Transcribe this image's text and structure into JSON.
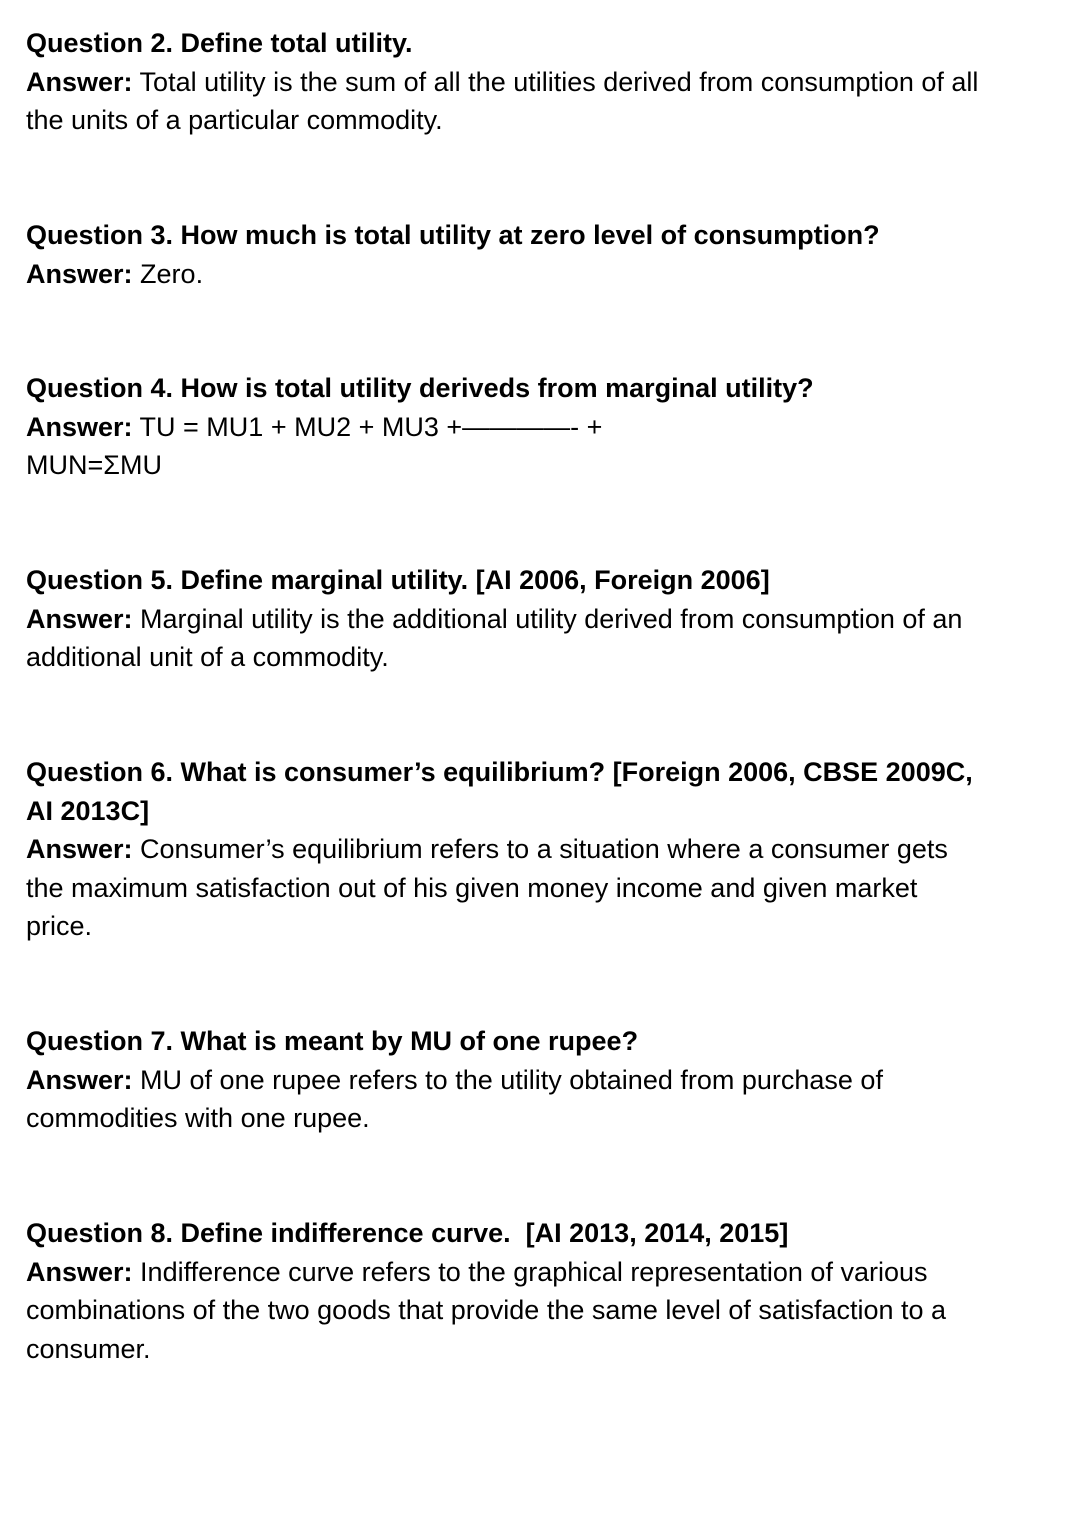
{
  "answer_label": "Answer:",
  "items": [
    {
      "question": "Question 2. Define total utility.",
      "answer_lines": [
        "Total utility is the sum of all the utilities derived from consumption of all",
        "the units of a particular commodity."
      ]
    },
    {
      "question": "Question 3. How much is total utility at zero level of consumption?",
      "answer_lines": [
        "Zero."
      ]
    },
    {
      "question": "Question 4. How is total utility deriveds from marginal utility?",
      "answer_lines": [
        "TU = MU1 + MU2 + MU3 +————- +",
        "MUN=ΣMU"
      ]
    },
    {
      "question": "Question 5. Define marginal utility. [AI 2006, Foreign 2006]",
      "answer_lines": [
        "Marginal utility is the additional utility derived from consumption of an",
        "additional unit of a commodity."
      ]
    },
    {
      "question_lines": [
        "Question 6. What is consumer’s equilibrium? [Foreign 2006, CBSE 2009C,",
        "AI 2013C]"
      ],
      "answer_lines": [
        "Consumer’s equilibrium refers to a situation where a consumer gets",
        "the maximum satisfaction out of his given money income and given market",
        "price."
      ]
    },
    {
      "question": "Question 7. What is meant by MU of one rupee?",
      "answer_lines": [
        "MU of one rupee refers to the utility obtained from purchase of",
        "commodities with one rupee."
      ]
    },
    {
      "question": "Question 8. Define indifference curve.  [AI 2013, 2014, 2015]",
      "answer_lines": [
        "Indifference curve refers to the graphical representation of various",
        "combinations of the two goods that provide the same level of satisfaction to a",
        "consumer."
      ]
    }
  ]
}
